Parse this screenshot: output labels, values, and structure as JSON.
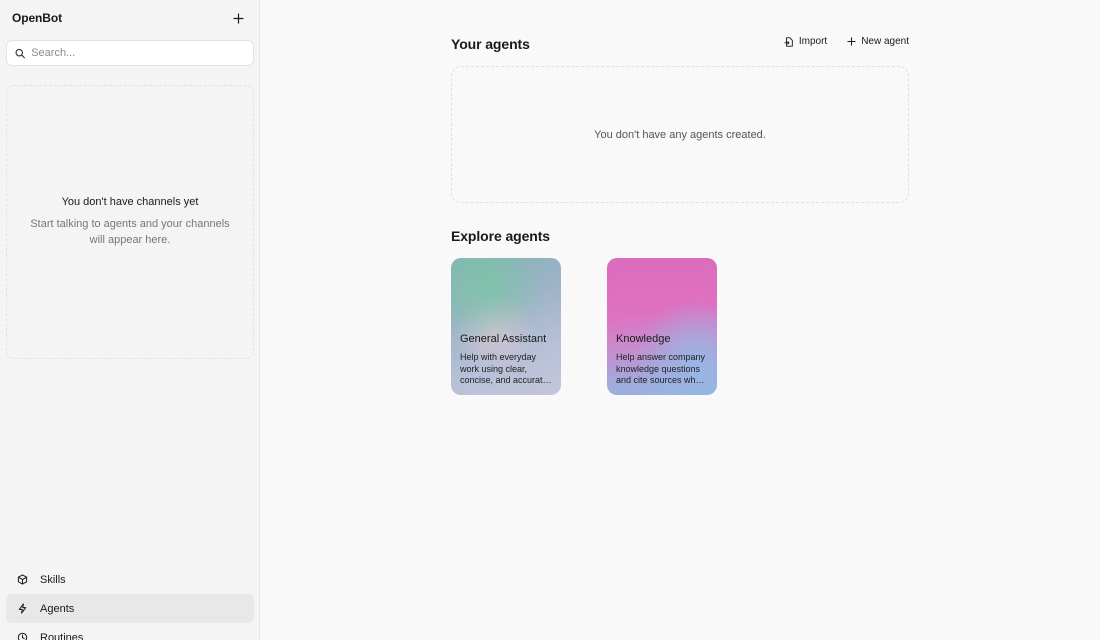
{
  "app": {
    "title": "OpenBot"
  },
  "sidebar": {
    "search_placeholder": "Search...",
    "empty_channels": {
      "title": "You don't have channels yet",
      "subtitle": "Start talking to agents and your channels will appear here."
    },
    "nav": [
      {
        "label": "Skills",
        "icon": "cube-icon",
        "active": false
      },
      {
        "label": "Agents",
        "icon": "bolt-icon",
        "active": true
      },
      {
        "label": "Routines",
        "icon": "clock-icon",
        "active": false
      }
    ]
  },
  "main": {
    "your_agents": {
      "title": "Your agents",
      "import_label": "Import",
      "new_agent_label": "New agent",
      "empty_text": "You don't have any agents created."
    },
    "explore": {
      "title": "Explore agents",
      "cards": [
        {
          "title": "General Assistant",
          "description": "Help with everyday work using clear, concise, and accurat…"
        },
        {
          "title": "Knowledge",
          "description": "Help answer company knowledge questions and cite sources wh…"
        }
      ]
    }
  }
}
